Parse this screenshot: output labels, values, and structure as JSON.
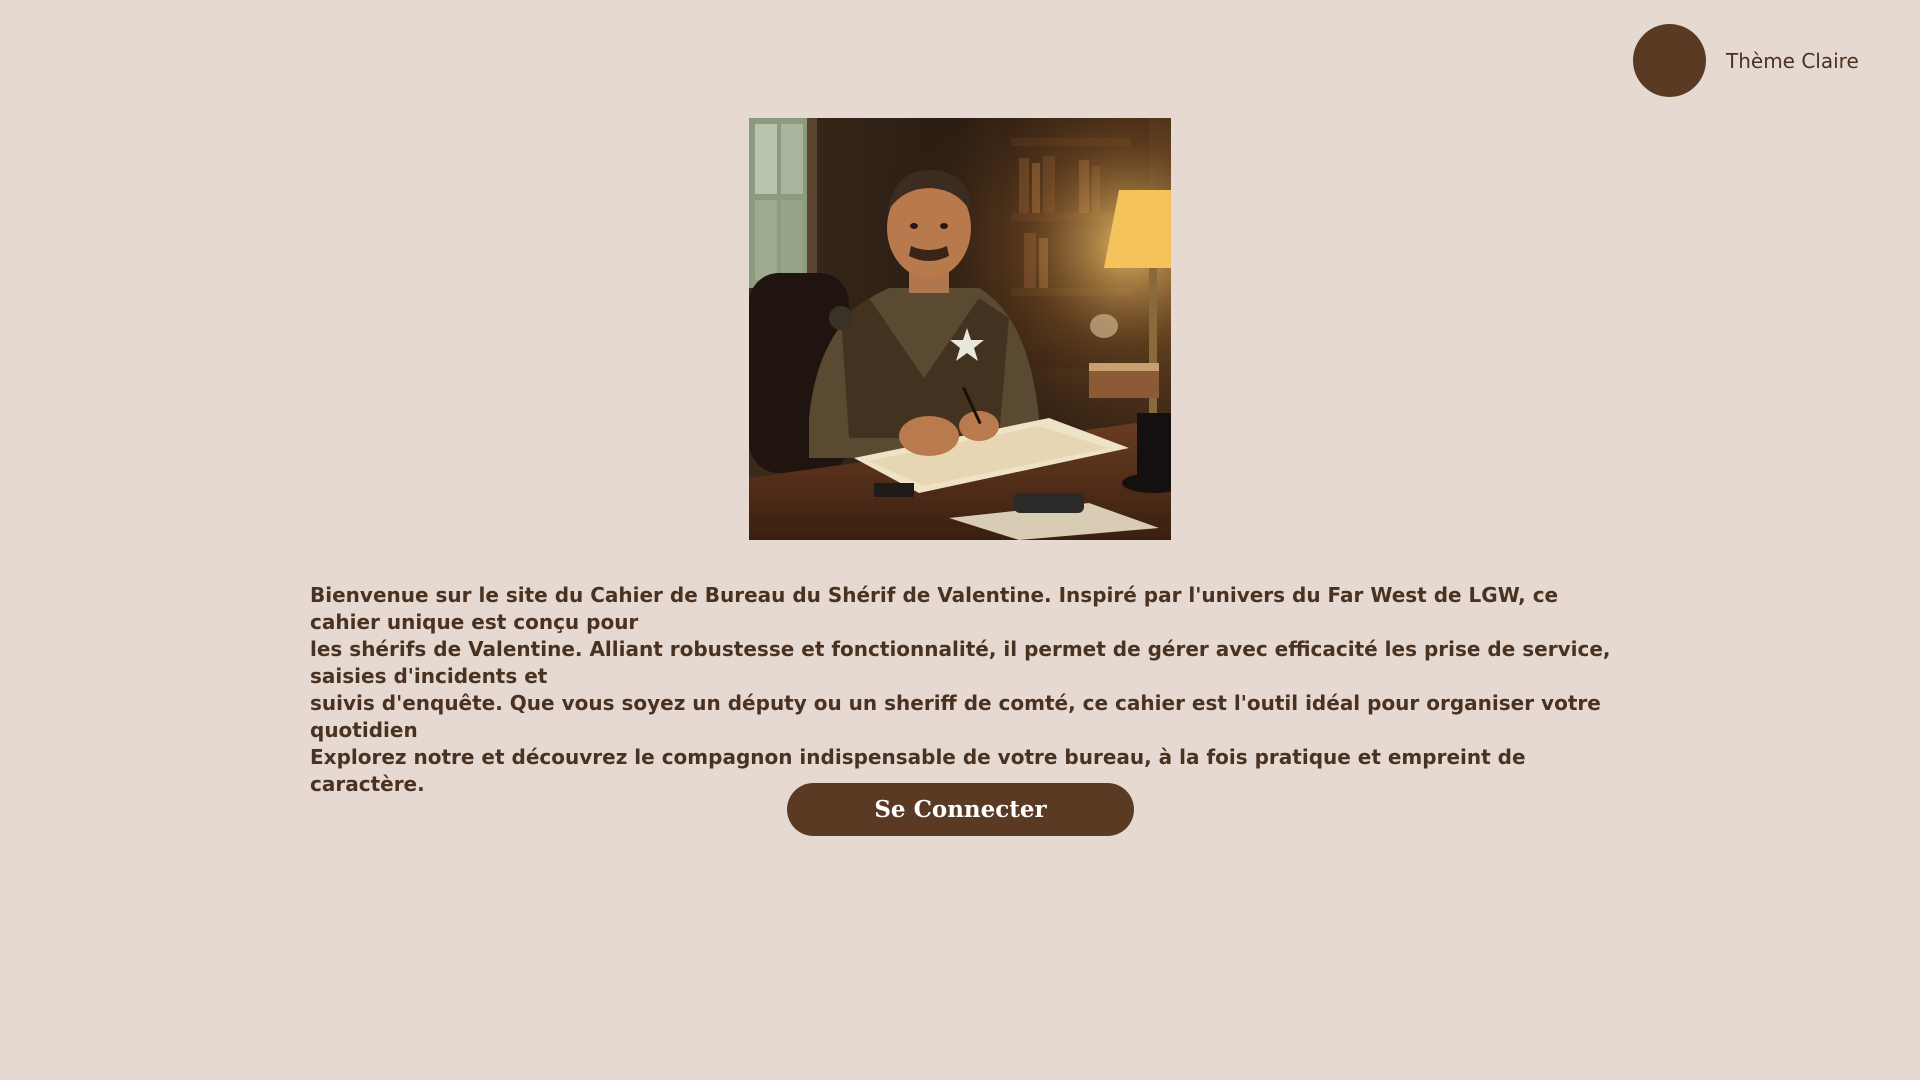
{
  "theme_toggle": {
    "label": "Thème Claire",
    "circle_color": "#5a3a22"
  },
  "hero_image": {
    "alt": "Shérif à son bureau"
  },
  "intro": {
    "line1": "Bienvenue sur le site du Cahier de Bureau du Shérif de Valentine. Inspiré par l'univers du Far West de LGW, ce cahier unique est conçu pour",
    "line2": "les shérifs de Valentine. Alliant robustesse et fonctionnalité, il permet de gérer avec efficacité les prise de service, saisies  d'incidents et",
    "line3": "suivis d'enquête. Que vous soyez un députy ou un sheriff de comté, ce cahier est l'outil idéal pour organiser votre quotidien",
    "line4": "Explorez notre et découvrez le compagnon indispensable de votre bureau, à la fois pratique et empreint de caractère."
  },
  "connect_button": {
    "label": "Se Connecter"
  },
  "colors": {
    "background": "#e6d9d1",
    "accent": "#5a3a22",
    "text": "#4a3222"
  }
}
